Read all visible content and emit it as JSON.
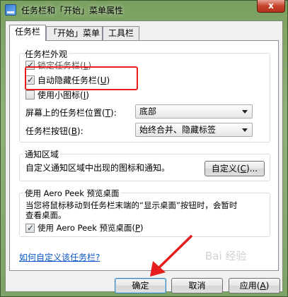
{
  "window": {
    "title": "任务栏和「开始」菜单属性",
    "close_label": "x"
  },
  "tabs": [
    {
      "label": "任务栏",
      "active": true
    },
    {
      "label": "「开始」菜单",
      "active": false
    },
    {
      "label": "工具栏",
      "active": false
    }
  ],
  "appearance": {
    "group_title": "任务栏外观",
    "lock": {
      "label": "锁定任务栏(",
      "key": "L",
      "suffix": ")",
      "checked": true
    },
    "autohide": {
      "label": "自动隐藏任务栏(",
      "key": "U",
      "suffix": ")",
      "checked": true
    },
    "small_icons": {
      "label": "使用小图标(",
      "key": "I",
      "suffix": ")",
      "checked": false
    },
    "position": {
      "label": "屏幕上的任务栏位置(",
      "key": "T",
      "suffix": "):",
      "value": "底部"
    },
    "buttons": {
      "label": "任务栏按钮(",
      "key": "B",
      "suffix": "):",
      "value": "始终合并、隐藏标签"
    }
  },
  "notification": {
    "group_title": "通知区域",
    "description": "自定义通知区域中出现的图标和通知。",
    "customize_button": {
      "label": "自定义(",
      "key": "C",
      "suffix": ")..."
    }
  },
  "aero": {
    "group_title": "使用 Aero Peek 预览桌面",
    "description_line1": "当您将鼠标移动到任务栏末端的“显示桌面”按钮时，会暂时",
    "description_line2": "查看桌面。",
    "checkbox": {
      "label": "使用 Aero Peek 预览桌面(",
      "key": "P",
      "suffix": ")",
      "checked": true
    }
  },
  "help_link": "如何自定义该任务栏?",
  "footer": {
    "ok": "确定",
    "cancel": "取消",
    "apply": {
      "label": "应用(",
      "key": "A",
      "suffix": ")"
    }
  },
  "watermark": "Bai 经验",
  "colors": {
    "highlight": "#e51d1d",
    "link": "#0b56c5"
  }
}
